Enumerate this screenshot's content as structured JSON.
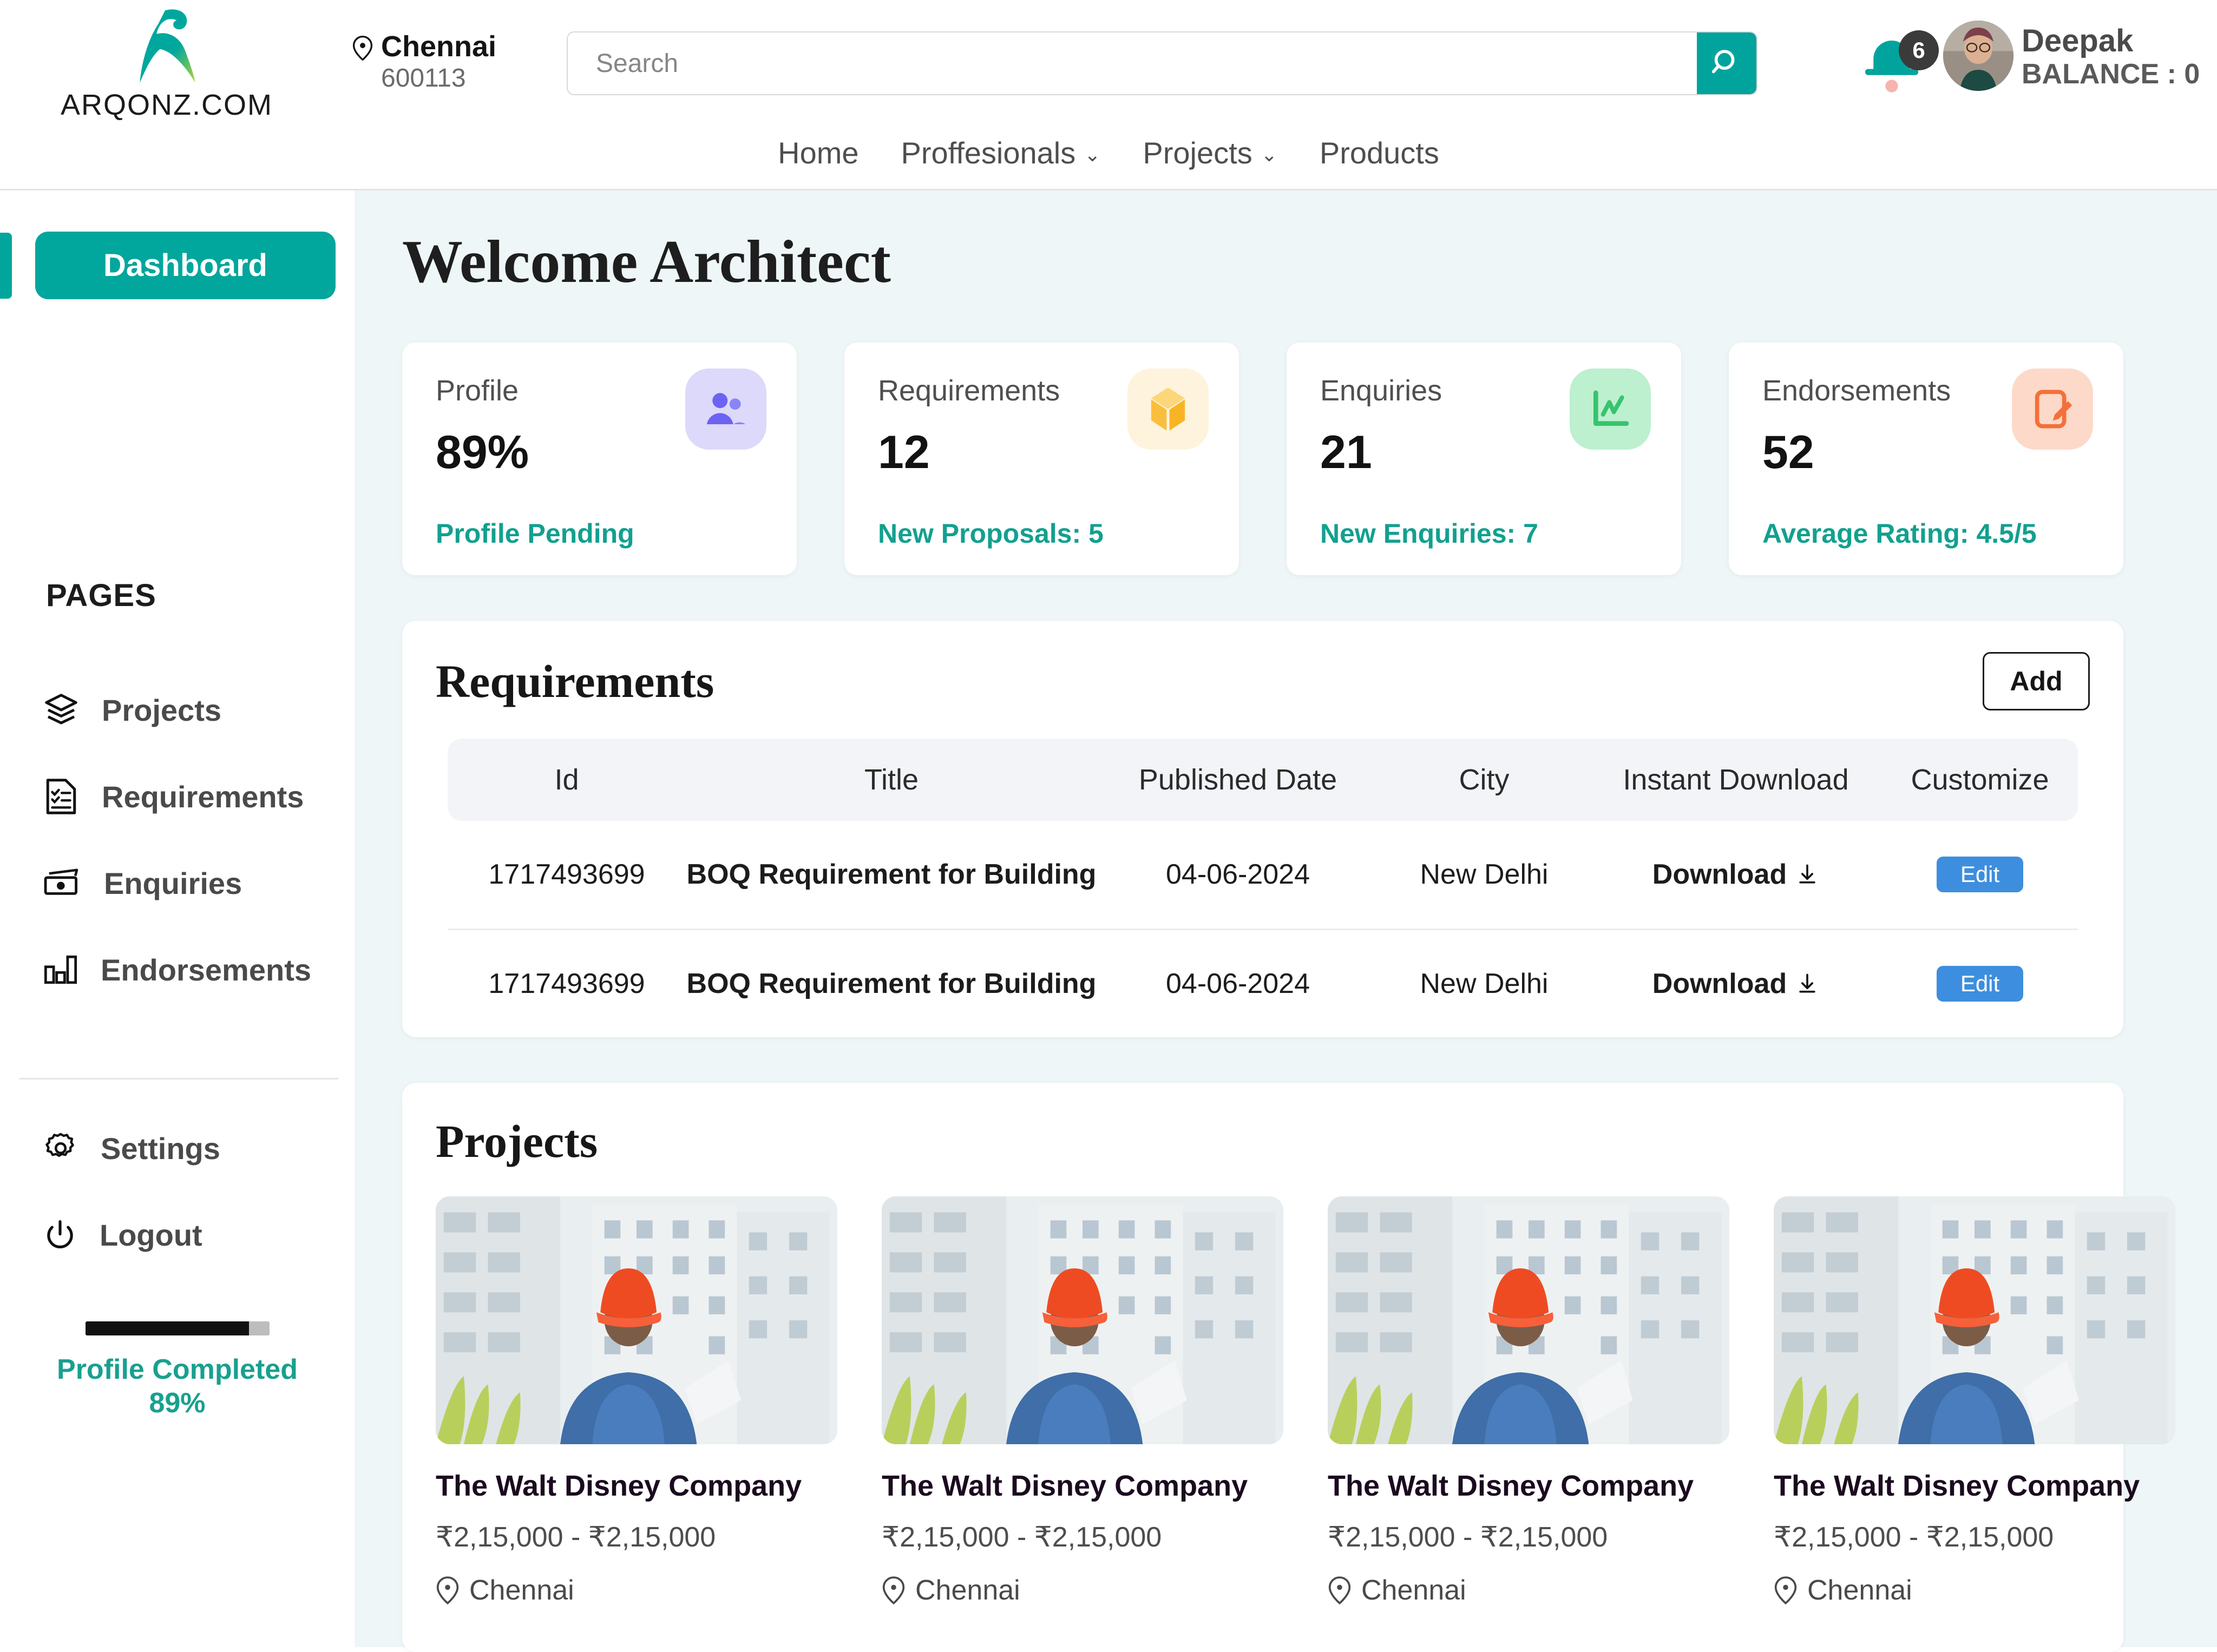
{
  "brand": {
    "name": "ARQONZ.COM"
  },
  "location": {
    "city": "Chennai",
    "zip": "600113"
  },
  "search": {
    "placeholder": "Search",
    "value": "",
    "icon": "search-icon"
  },
  "notifications": {
    "count": "6",
    "icon": "bell-icon"
  },
  "user": {
    "name": "Deepak",
    "balance_label": "BALANCE : 0",
    "avatar": "user-avatar"
  },
  "nav": {
    "items": [
      {
        "label": "Home",
        "has_caret": false
      },
      {
        "label": "Proffesionals",
        "has_caret": true
      },
      {
        "label": "Projects",
        "has_caret": true
      },
      {
        "label": "Products",
        "has_caret": false
      }
    ]
  },
  "sidebar": {
    "dashboard_label": "Dashboard",
    "section_label": "PAGES",
    "items": [
      {
        "label": "Projects",
        "icon": "layers-icon"
      },
      {
        "label": "Requirements",
        "icon": "checklist-document-icon"
      },
      {
        "label": "Enquiries",
        "icon": "money-bill-icon"
      },
      {
        "label": "Endorsements",
        "icon": "bar-chart-icon"
      }
    ],
    "items2": [
      {
        "label": "Settings",
        "icon": "gear-icon"
      },
      {
        "label": "Logout",
        "icon": "power-icon"
      }
    ],
    "progress": {
      "percent": 89,
      "line1": "Profile Completed",
      "line2": "89%"
    }
  },
  "main": {
    "title": "Welcome Architect",
    "stats": [
      {
        "title": "Profile",
        "value": "89%",
        "sub": "Profile Pending",
        "icon": "people-icon",
        "icon_bg": "#ddd9fb",
        "icon_color": "#6c63f5"
      },
      {
        "title": "Requirements",
        "value": "12",
        "sub": "New Proposals: 5",
        "icon": "box-icon",
        "icon_bg": "#fef3dc",
        "icon_color": "#fbbe3c"
      },
      {
        "title": "Enquiries",
        "value": "21",
        "sub": "New Enquiries: 7",
        "icon": "line-chart-icon",
        "icon_bg": "#bdf0cf",
        "icon_color": "#37c46e"
      },
      {
        "title": "Endorsements",
        "value": "52",
        "sub": "Average Rating: 4.5/5",
        "icon": "sign-document-icon",
        "icon_bg": "#fdd9c9",
        "icon_color": "#f4703a"
      }
    ],
    "requirements": {
      "title": "Requirements",
      "add_label": "Add",
      "columns": [
        "Id",
        "Title",
        "Published Date",
        "City",
        "Instant Download",
        "Customize"
      ],
      "rows": [
        {
          "id": "1717493699",
          "title": "BOQ Requirement for Building",
          "published_date": "04-06-2024",
          "city": "New Delhi",
          "download_label": "Download",
          "edit_label": "Edit"
        },
        {
          "id": "1717493699",
          "title": "BOQ Requirement for Building",
          "published_date": "04-06-2024",
          "city": "New Delhi",
          "download_label": "Download",
          "edit_label": "Edit"
        }
      ]
    },
    "projects": {
      "title": "Projects",
      "cards": [
        {
          "name": "The Walt Disney Company",
          "price": "₹2,15,000 - ₹2,15,000",
          "city": "Chennai"
        },
        {
          "name": "The Walt Disney Company",
          "price": "₹2,15,000 - ₹2,15,000",
          "city": "Chennai"
        },
        {
          "name": "The Walt Disney Company",
          "price": "₹2,15,000 - ₹2,15,000",
          "city": "Chennai"
        },
        {
          "name": "The Walt Disney Company",
          "price": "₹2,15,000 - ₹2,15,000",
          "city": "Chennai"
        }
      ]
    }
  },
  "colors": {
    "accent_teal": "#01a49c",
    "accent_green_text": "#12a08f",
    "edit_blue": "#3d8ede",
    "main_bg": "#eef6f7"
  }
}
